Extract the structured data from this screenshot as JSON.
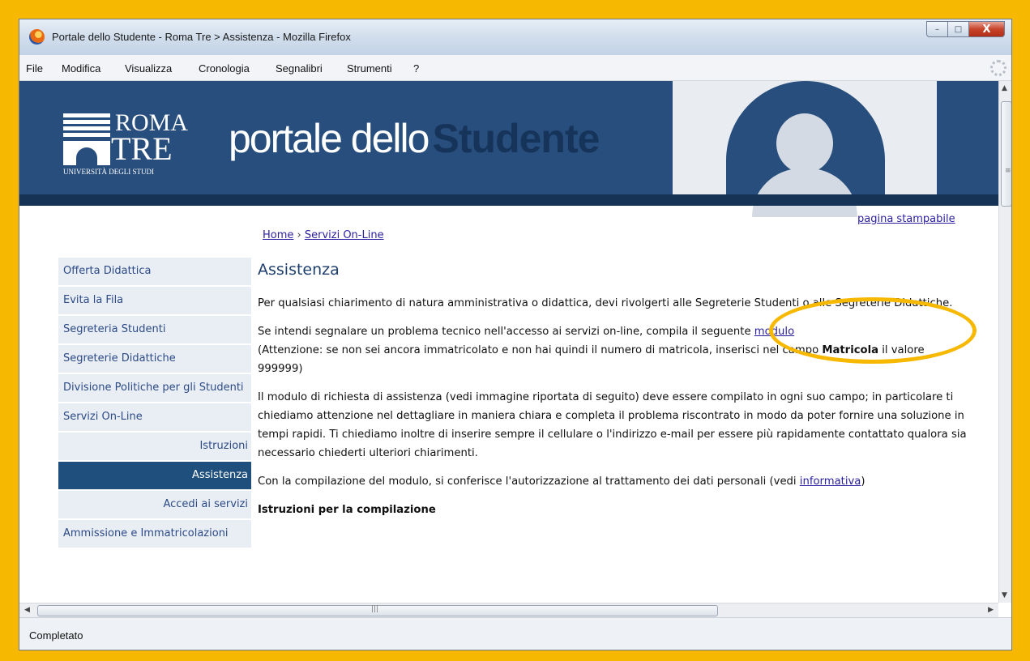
{
  "window": {
    "title": "Portale dello Studente - Roma Tre > Assistenza - Mozilla Firefox",
    "controls": {
      "minimize": "–",
      "maximize": "□",
      "close": "X"
    }
  },
  "menubar": {
    "items": [
      "File",
      "Modifica",
      "Visualizza",
      "Cronologia",
      "Segnalibri",
      "Strumenti",
      "?"
    ]
  },
  "banner": {
    "logo_roma": "ROMA",
    "logo_tre": "TRE",
    "logo_university": "UNIVERSITÀ DEGLI STUDI",
    "title_light": "portale dello",
    "title_dark": "Studente"
  },
  "page": {
    "print_link": "pagina stampabile",
    "breadcrumb": {
      "home": "Home",
      "separator": " › ",
      "current": "Servizi On-Line"
    },
    "sidebar": [
      {
        "label": "Offerta Didattica"
      },
      {
        "label": "Evita la Fila"
      },
      {
        "label": "Segreteria Studenti"
      },
      {
        "label": "Segreterie Didattiche"
      },
      {
        "label": "Divisione Politiche per gli Studenti"
      },
      {
        "label": "Servizi On-Line"
      },
      {
        "label": "Istruzioni"
      },
      {
        "label": "Assistenza"
      },
      {
        "label": "Accedi ai servizi"
      },
      {
        "label": "Ammissione e Immatricolazioni"
      }
    ],
    "heading": "Assistenza",
    "para1": "Per qualsiasi chiarimento di natura amministrativa o didattica, devi rivolgerti alle Segreterie Studenti o alle Segreterie Didattiche.",
    "para2_before": "Se intendi segnalare un problema tecnico nell'accesso ai servizi on-line, compila il seguente ",
    "para2_link": "modulo",
    "para2_after": "(Attenzione: se non sei ancora immatricolato e non hai quindi il numero di matricola, inserisci nel campo ",
    "para2_bold": "Matricola",
    "para2_end": " il valore 999999)",
    "para3": "Il modulo di richiesta di assistenza (vedi immagine riportata di seguito) deve essere compilato in ogni suo campo; in particolare ti chiediamo attenzione nel dettagliare in maniera chiara e completa il problema riscontrato in modo da poter fornire una soluzione in tempi rapidi. Ti chiediamo inoltre di inserire sempre il cellulare o l'indirizzo e-mail per essere più rapidamente contattato qualora sia necessario chiederti ulteriori chiarimenti.",
    "para4_before": "Con la compilazione del modulo, si conferisce l'autorizzazione al trattamento dei dati personali (vedi ",
    "para4_link": "informativa",
    "para4_end": ")",
    "subheading": "Istruzioni per la compilazione"
  },
  "statusbar": {
    "text": "Completato"
  },
  "colors": {
    "frame": "#f6b800",
    "banner": "#284e7d",
    "link": "#2a1f9e",
    "active_nav": "#1f4f7c"
  },
  "icons": [
    "firefox-icon",
    "throbber-icon"
  ]
}
